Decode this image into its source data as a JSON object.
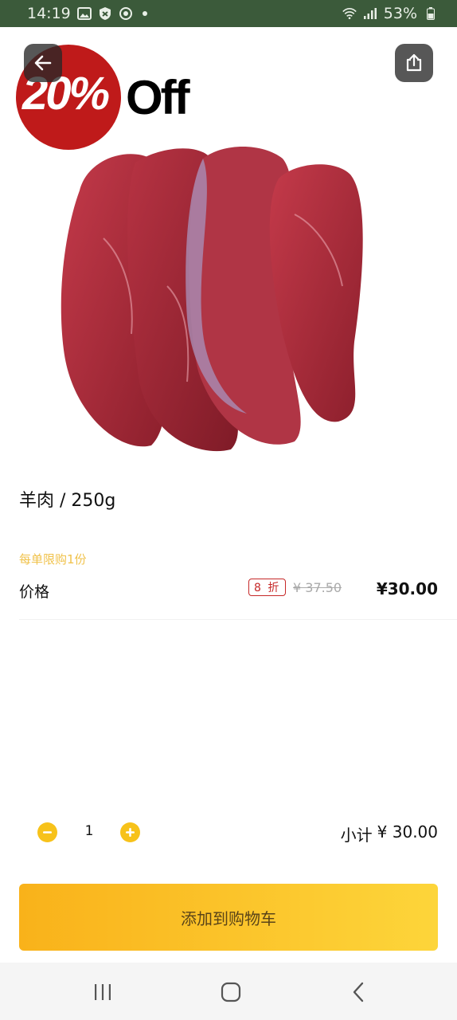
{
  "status_bar": {
    "time": "14:19",
    "battery": "53%",
    "icons": [
      "gallery-icon",
      "shield-icon",
      "sync-icon",
      "notification-dot-icon",
      "wifi-icon",
      "signal-icon",
      "battery-icon"
    ]
  },
  "hero": {
    "promo_percent": "20%",
    "promo_off": "Off",
    "promo_color": "#bf1a1a"
  },
  "product": {
    "title": "羊肉 / 250g",
    "limit_note": "每单限购1份",
    "price_label": "价格",
    "discount_badge": "8 折",
    "original_price": "¥ 37.50",
    "current_price": "¥30.00"
  },
  "cart": {
    "quantity": "1",
    "subtotal_label": "小计",
    "subtotal_value": "¥ 30.00",
    "add_to_cart": "添加到购物车"
  },
  "colors": {
    "accent": "#f7c21a",
    "status_bar": "#3b5a3a",
    "discount_red": "#c62828"
  }
}
